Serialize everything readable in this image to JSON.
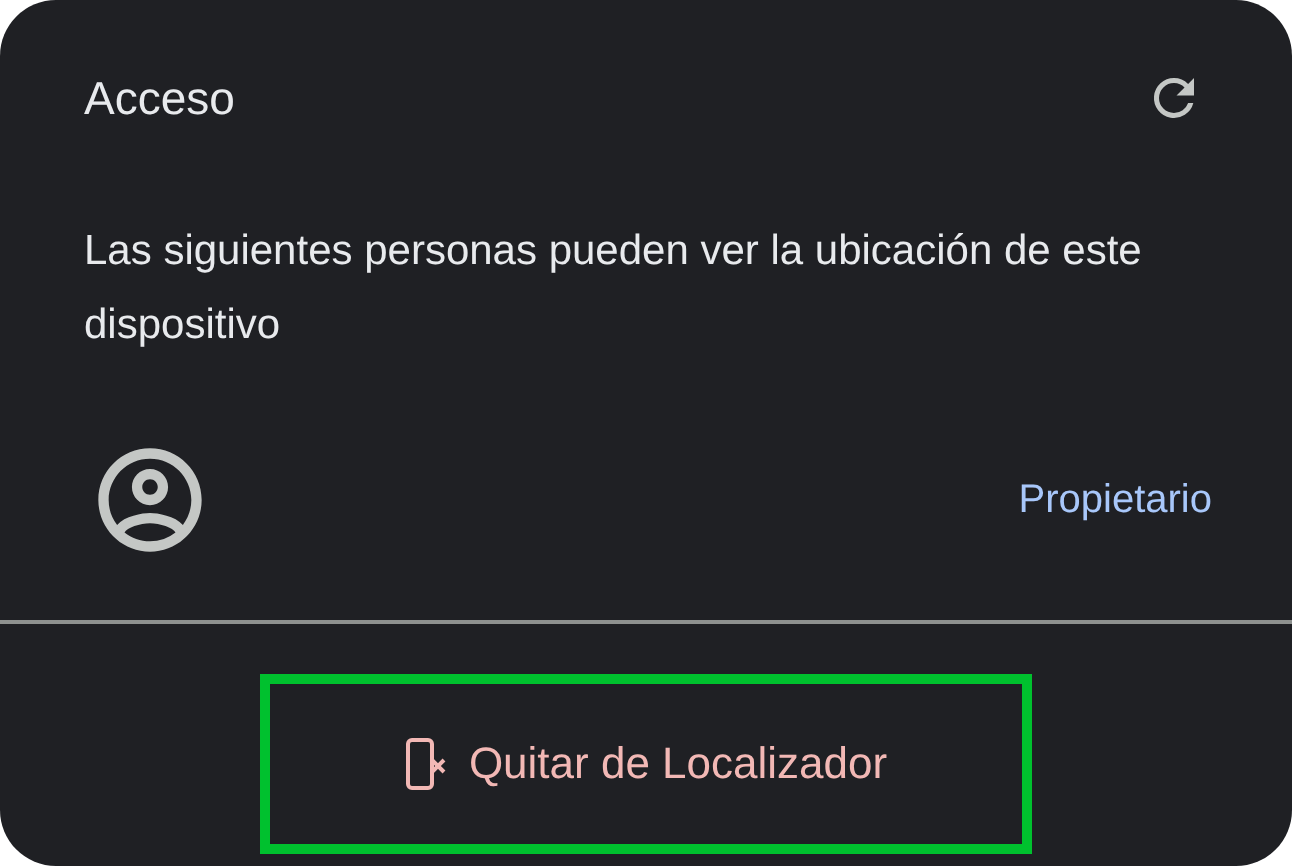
{
  "card": {
    "title": "Acceso",
    "description": "Las siguientes personas pueden ver la ubicación de este dispositivo"
  },
  "people": [
    {
      "role": "Propietario"
    }
  ],
  "action": {
    "label": "Quitar de Localizador",
    "highlighted": true
  }
}
